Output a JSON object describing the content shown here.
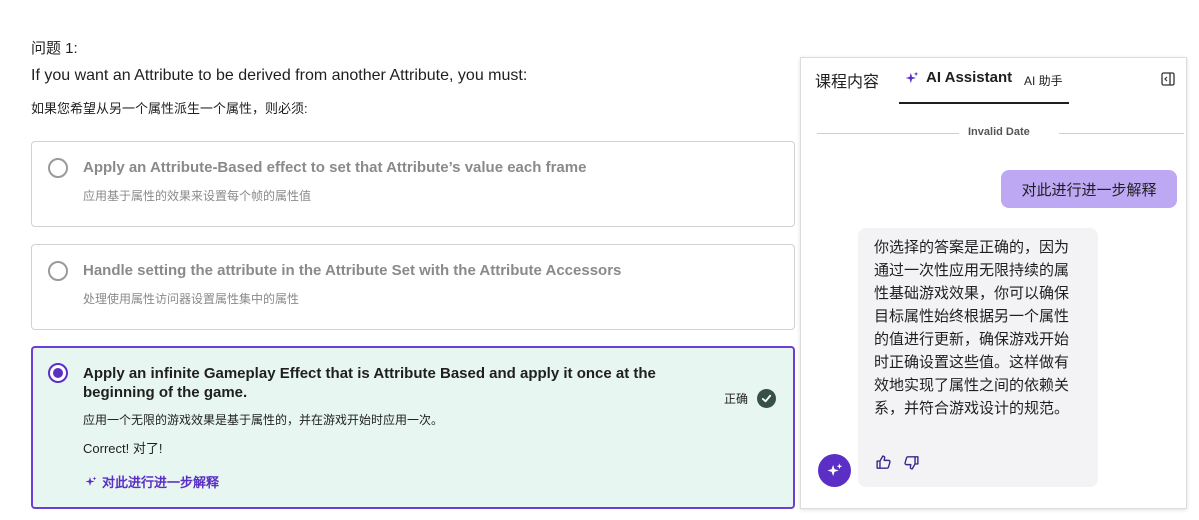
{
  "question": {
    "label": "问题 1:",
    "text_en": "If you want an Attribute to be derived from another Attribute, you must:",
    "text_zh": "如果您希望从另一个属性派生一个属性，则必须:"
  },
  "options": [
    {
      "title": "Apply an Attribute-Based effect to set that Attribute’s value each frame",
      "subtitle": "应用基于属性的效果来设置每个帧的属性值",
      "selected": false
    },
    {
      "title": "Handle setting the attribute in the Attribute Set with the Attribute Accessors",
      "subtitle": "处理使用属性访问器设置属性集中的属性",
      "selected": false
    },
    {
      "title": "Apply an infinite Gameplay Effect that is Attribute Based and apply it once at the beginning of the game.",
      "subtitle": "应用一个无限的游戏效果是基于属性的，并在游戏开始时应用一次。",
      "selected": true,
      "feedback": "Correct!  对了!",
      "status_label": "正确",
      "explain_link": "对此进行进一步解释"
    }
  ],
  "panel": {
    "tab_course": "课程内容",
    "tab_ai": "AI Assistant",
    "tab_ai_zh": "AI 助手",
    "date_divider": "Invalid Date",
    "user_message": "对此进行进一步解释",
    "ai_message": "你选择的答案是正确的，因为通过一次性应用无限持续的属性基础游戏效果，你可以确保目标属性始终根据另一个属性的值进行更新，确保游戏开始时正确设置这些值。这样做有效地实现了属性之间的依赖关系，并符合游戏设计的规范。"
  },
  "colors": {
    "accent": "#5b2fc5",
    "selected_bg": "#e8f6f1",
    "user_bubble": "#bda8f3",
    "ai_bubble": "#f3f3f6",
    "check": "#37514a"
  },
  "icons": {
    "sparkle": "sparkle-icon",
    "check": "check-circle-icon",
    "collapse": "collapse-panel-icon",
    "thumbs_up": "thumbs-up-icon",
    "thumbs_down": "thumbs-down-icon"
  }
}
